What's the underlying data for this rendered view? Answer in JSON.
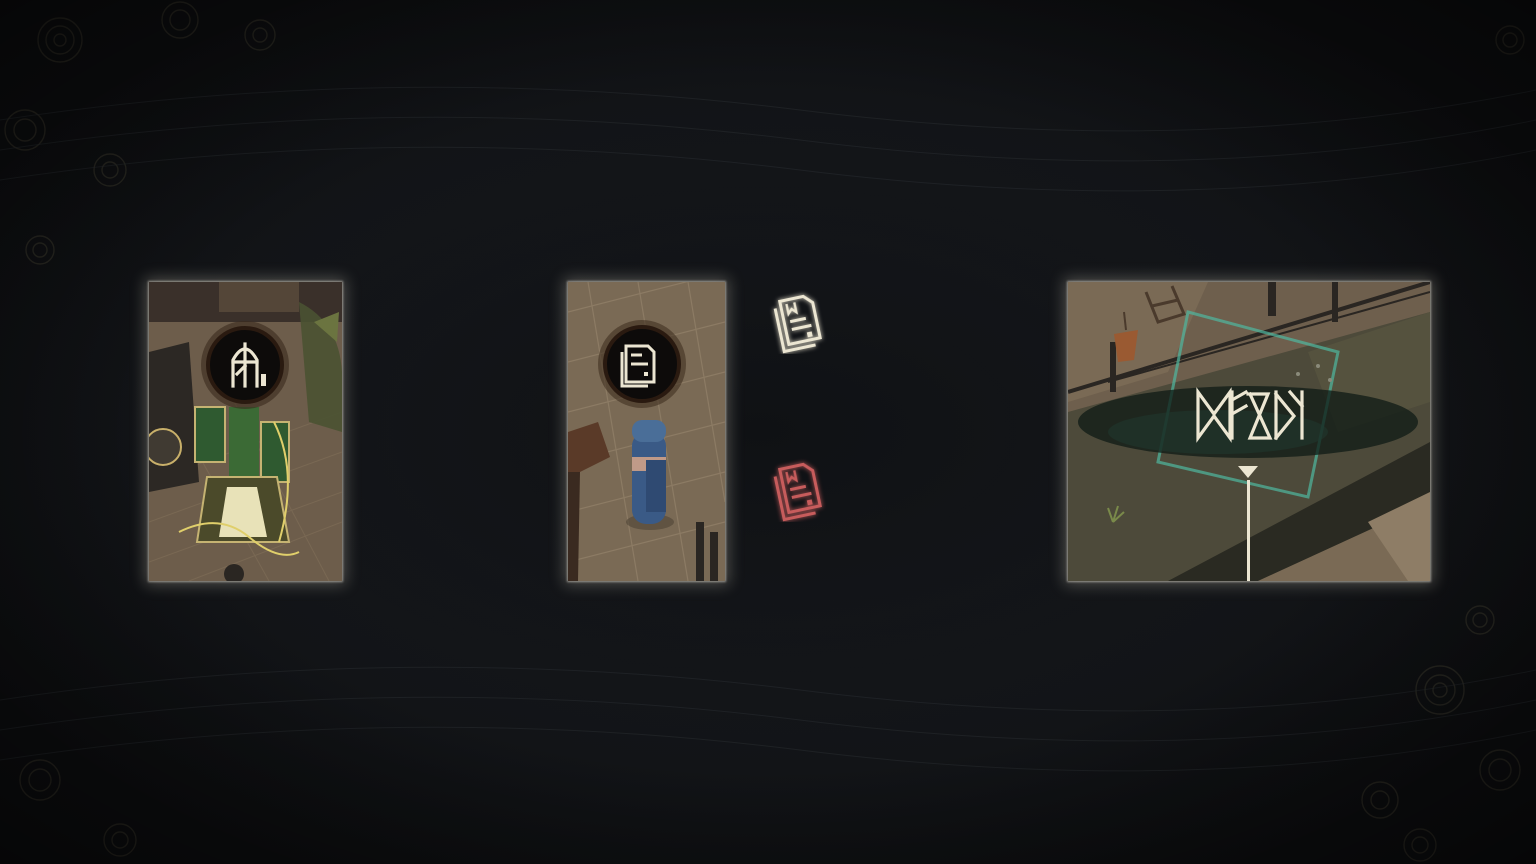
{
  "tutorial": {
    "cards": [
      {
        "id": "door-interaction",
        "icon": "door-rune-icon"
      },
      {
        "id": "note-pickup",
        "icon": "note-icon"
      },
      {
        "id": "destination-marker",
        "icon": "rune-label-icon",
        "label_runes": "ᛞᚠᛝᛞ"
      }
    ],
    "legend_icons": [
      {
        "icon": "note-icon-unread",
        "color": "#e8e2cc"
      },
      {
        "icon": "note-icon-read",
        "color": "#d06a6a"
      }
    ]
  },
  "colors": {
    "background": "#131519",
    "card_glow": "#e6e1d2",
    "icon_light": "#ece6d2",
    "icon_red": "#c75b5b",
    "marker_teal": "#4fb8a0"
  }
}
